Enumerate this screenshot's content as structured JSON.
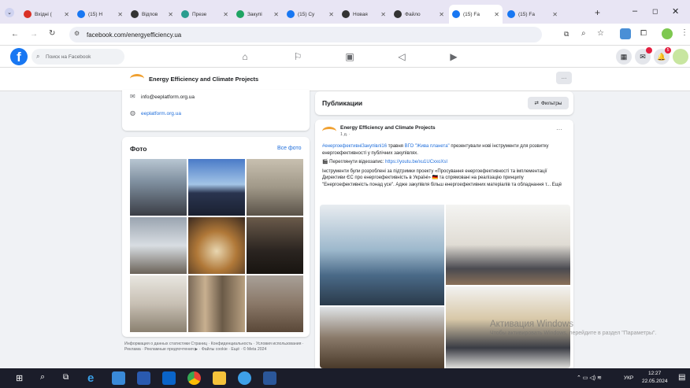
{
  "browser": {
    "tabs": [
      {
        "label": "Вхідні (",
        "icon": "gmail-icon",
        "color": "#d93025"
      },
      {
        "label": "(15) Н",
        "icon": "facebook-icon",
        "color": "#1877f2"
      },
      {
        "label": "Відпов",
        "icon": "chatgpt-icon",
        "color": "#333"
      },
      {
        "label": "Презе",
        "icon": "slides-icon",
        "color": "#2a9d8f"
      },
      {
        "label": "Закупі",
        "icon": "drive-icon",
        "color": "#1fa463"
      },
      {
        "label": "(15) Су",
        "icon": "facebook-icon",
        "color": "#1877f2"
      },
      {
        "label": "Новая",
        "icon": "chatgpt-icon",
        "color": "#333"
      },
      {
        "label": "Файло",
        "icon": "file-icon",
        "color": "#333"
      },
      {
        "label": "(15) Fa",
        "icon": "facebook-icon",
        "color": "#1877f2"
      },
      {
        "label": "(15) Fa",
        "icon": "facebook-icon",
        "color": "#1877f2"
      }
    ],
    "new_tab": "+",
    "url": "facebook.com/energyefficiency.ua"
  },
  "fb": {
    "search_placeholder": "Поиск на Facebook",
    "notif_badges": [
      "",
      "5"
    ]
  },
  "page": {
    "name": "Energy Efficiency and Climate Projects",
    "more": "···"
  },
  "intro": {
    "email": "info@eeplatform.org.ua",
    "site": "eeplatform.org.ua"
  },
  "photos": {
    "title": "Фото",
    "all": "Все фото"
  },
  "footer": "Информация о данных статистики Страниц · Конфиденциальность · Условия использования · Реклама · Рекламные предпочтения ▶ · Файлы cookie · Ещё · © Meta 2024",
  "feed": {
    "title": "Публикации",
    "filters": "Фильтры",
    "post": {
      "author": "Energy Efficiency and Climate Projects",
      "time": "1 д. ·",
      "line1_hashtag": "#енергоефективніЗакупівлі16",
      "line1_mid": " травня ",
      "line1_org": "ВГО \"Жива планета\"",
      "line1_rest": " презентували нові інструменти для розвитку енергоефективності у публічних закупівлях.",
      "video_prefix": "🎬 Переглянути відеозапис: ",
      "video_link": "https://youtu.be/xu1UCxxoXsI",
      "body": "Інструменти були розроблені за підтримки проекту «Просування енергоефективності та імплементації Директиви ЄС про енергоефективність в Україні» 🇩🇪 та спрямовані на реалізацію принципу \"Енергоефективність понад усе\". Адже закупівля більш енергоефективних матеріалів та обладнання т... Ещё"
    }
  },
  "watermark": {
    "title": "Активация Windows",
    "sub": "Чтобы активировать Windows, перейдите в раздел \"Параметры\"."
  },
  "taskbar": {
    "lang": "УКР",
    "time": "12:27",
    "date": "22.05.2024"
  }
}
